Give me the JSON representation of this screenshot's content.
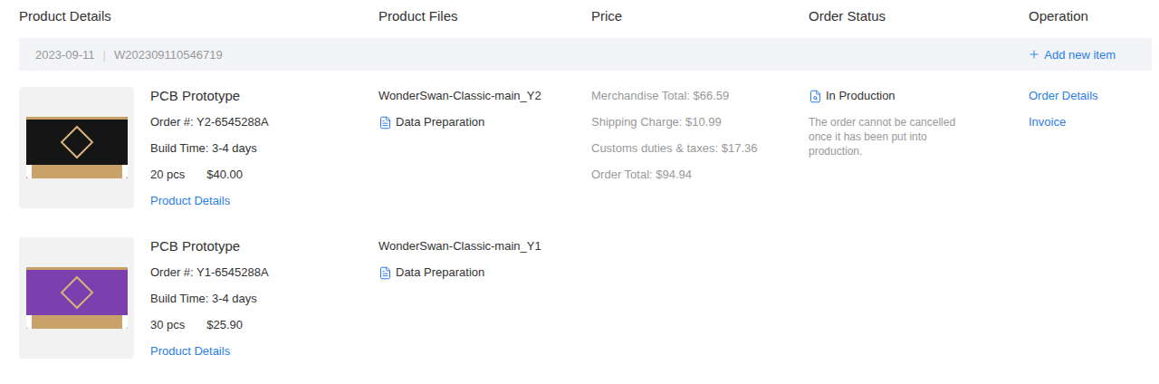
{
  "columns": [
    "Product Details",
    "Product Files",
    "Price",
    "Order Status",
    "Operation"
  ],
  "order": {
    "date": "2023-09-11",
    "separator": "|",
    "number": "W202309110546719",
    "add_item": "Add new item"
  },
  "items": [
    {
      "title": "PCB Prototype",
      "order_no": "Order #: Y2-6545288A",
      "build_time": "Build Time: 3-4 days",
      "quantity": "20 pcs",
      "price": "$40.00",
      "details_link": "Product Details",
      "file": "WonderSwan-Classic-main_Y2",
      "file_status": "Data Preparation",
      "color": "#151515"
    },
    {
      "title": "PCB Prototype",
      "order_no": "Order #: Y1-6545288A",
      "build_time": "Build Time: 3-4 days",
      "quantity": "30 pcs",
      "price": "$25.90",
      "details_link": "Product Details",
      "file": "WonderSwan-Classic-main_Y1",
      "file_status": "Data Preparation",
      "color": "#7b3fae"
    }
  ],
  "price": {
    "lines": [
      "Merchandise Total: $66.59",
      "Shipping Charge: $10.99",
      "Customs duties & taxes: $17.36",
      "Order Total: $94.94"
    ]
  },
  "status": {
    "label": "In Production",
    "note": "The order cannot be cancelled once it has been put into production."
  },
  "operations": [
    "Order Details",
    "Invoice"
  ]
}
